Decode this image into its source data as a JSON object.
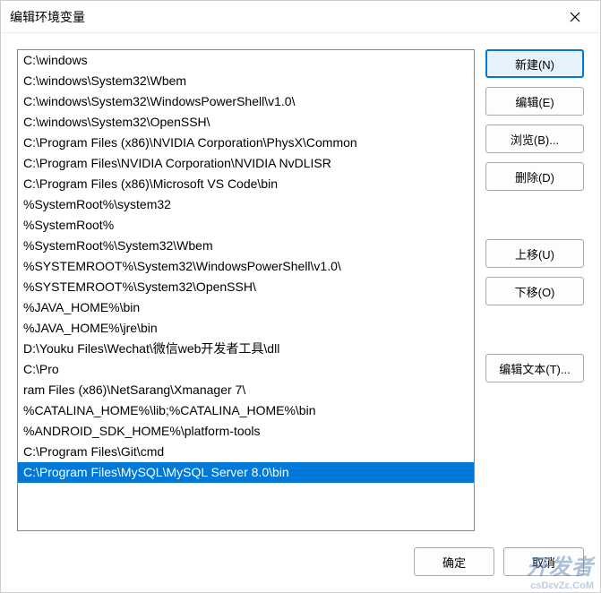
{
  "window": {
    "title": "编辑环境变量"
  },
  "list": {
    "items": [
      "C:\\windows",
      "C:\\windows\\System32\\Wbem",
      "C:\\windows\\System32\\WindowsPowerShell\\v1.0\\",
      "C:\\windows\\System32\\OpenSSH\\",
      "C:\\Program Files (x86)\\NVIDIA Corporation\\PhysX\\Common",
      "C:\\Program Files\\NVIDIA Corporation\\NVIDIA NvDLISR",
      "C:\\Program Files (x86)\\Microsoft VS Code\\bin",
      "%SystemRoot%\\system32",
      "%SystemRoot%",
      "%SystemRoot%\\System32\\Wbem",
      "%SYSTEMROOT%\\System32\\WindowsPowerShell\\v1.0\\",
      "%SYSTEMROOT%\\System32\\OpenSSH\\",
      "%JAVA_HOME%\\bin",
      "%JAVA_HOME%\\jre\\bin",
      "D:\\Youku Files\\Wechat\\微信web开发者工具\\dll",
      "C:\\Pro",
      "ram Files (x86)\\NetSarang\\Xmanager 7\\",
      "%CATALINA_HOME%\\lib;%CATALINA_HOME%\\bin",
      "%ANDROID_SDK_HOME%\\platform-tools",
      "C:\\Program Files\\Git\\cmd",
      "C:\\Program Files\\MySQL\\MySQL Server 8.0\\bin"
    ],
    "selectedIndex": 20
  },
  "buttons": {
    "new": "新建(N)",
    "edit": "编辑(E)",
    "browse": "浏览(B)...",
    "delete": "删除(D)",
    "moveUp": "上移(U)",
    "moveDown": "下移(O)",
    "editText": "编辑文本(T)...",
    "ok": "确定",
    "cancel": "取消"
  },
  "watermark": {
    "top": "开发者",
    "bottom": "csDɛvZɛ.CoM"
  }
}
